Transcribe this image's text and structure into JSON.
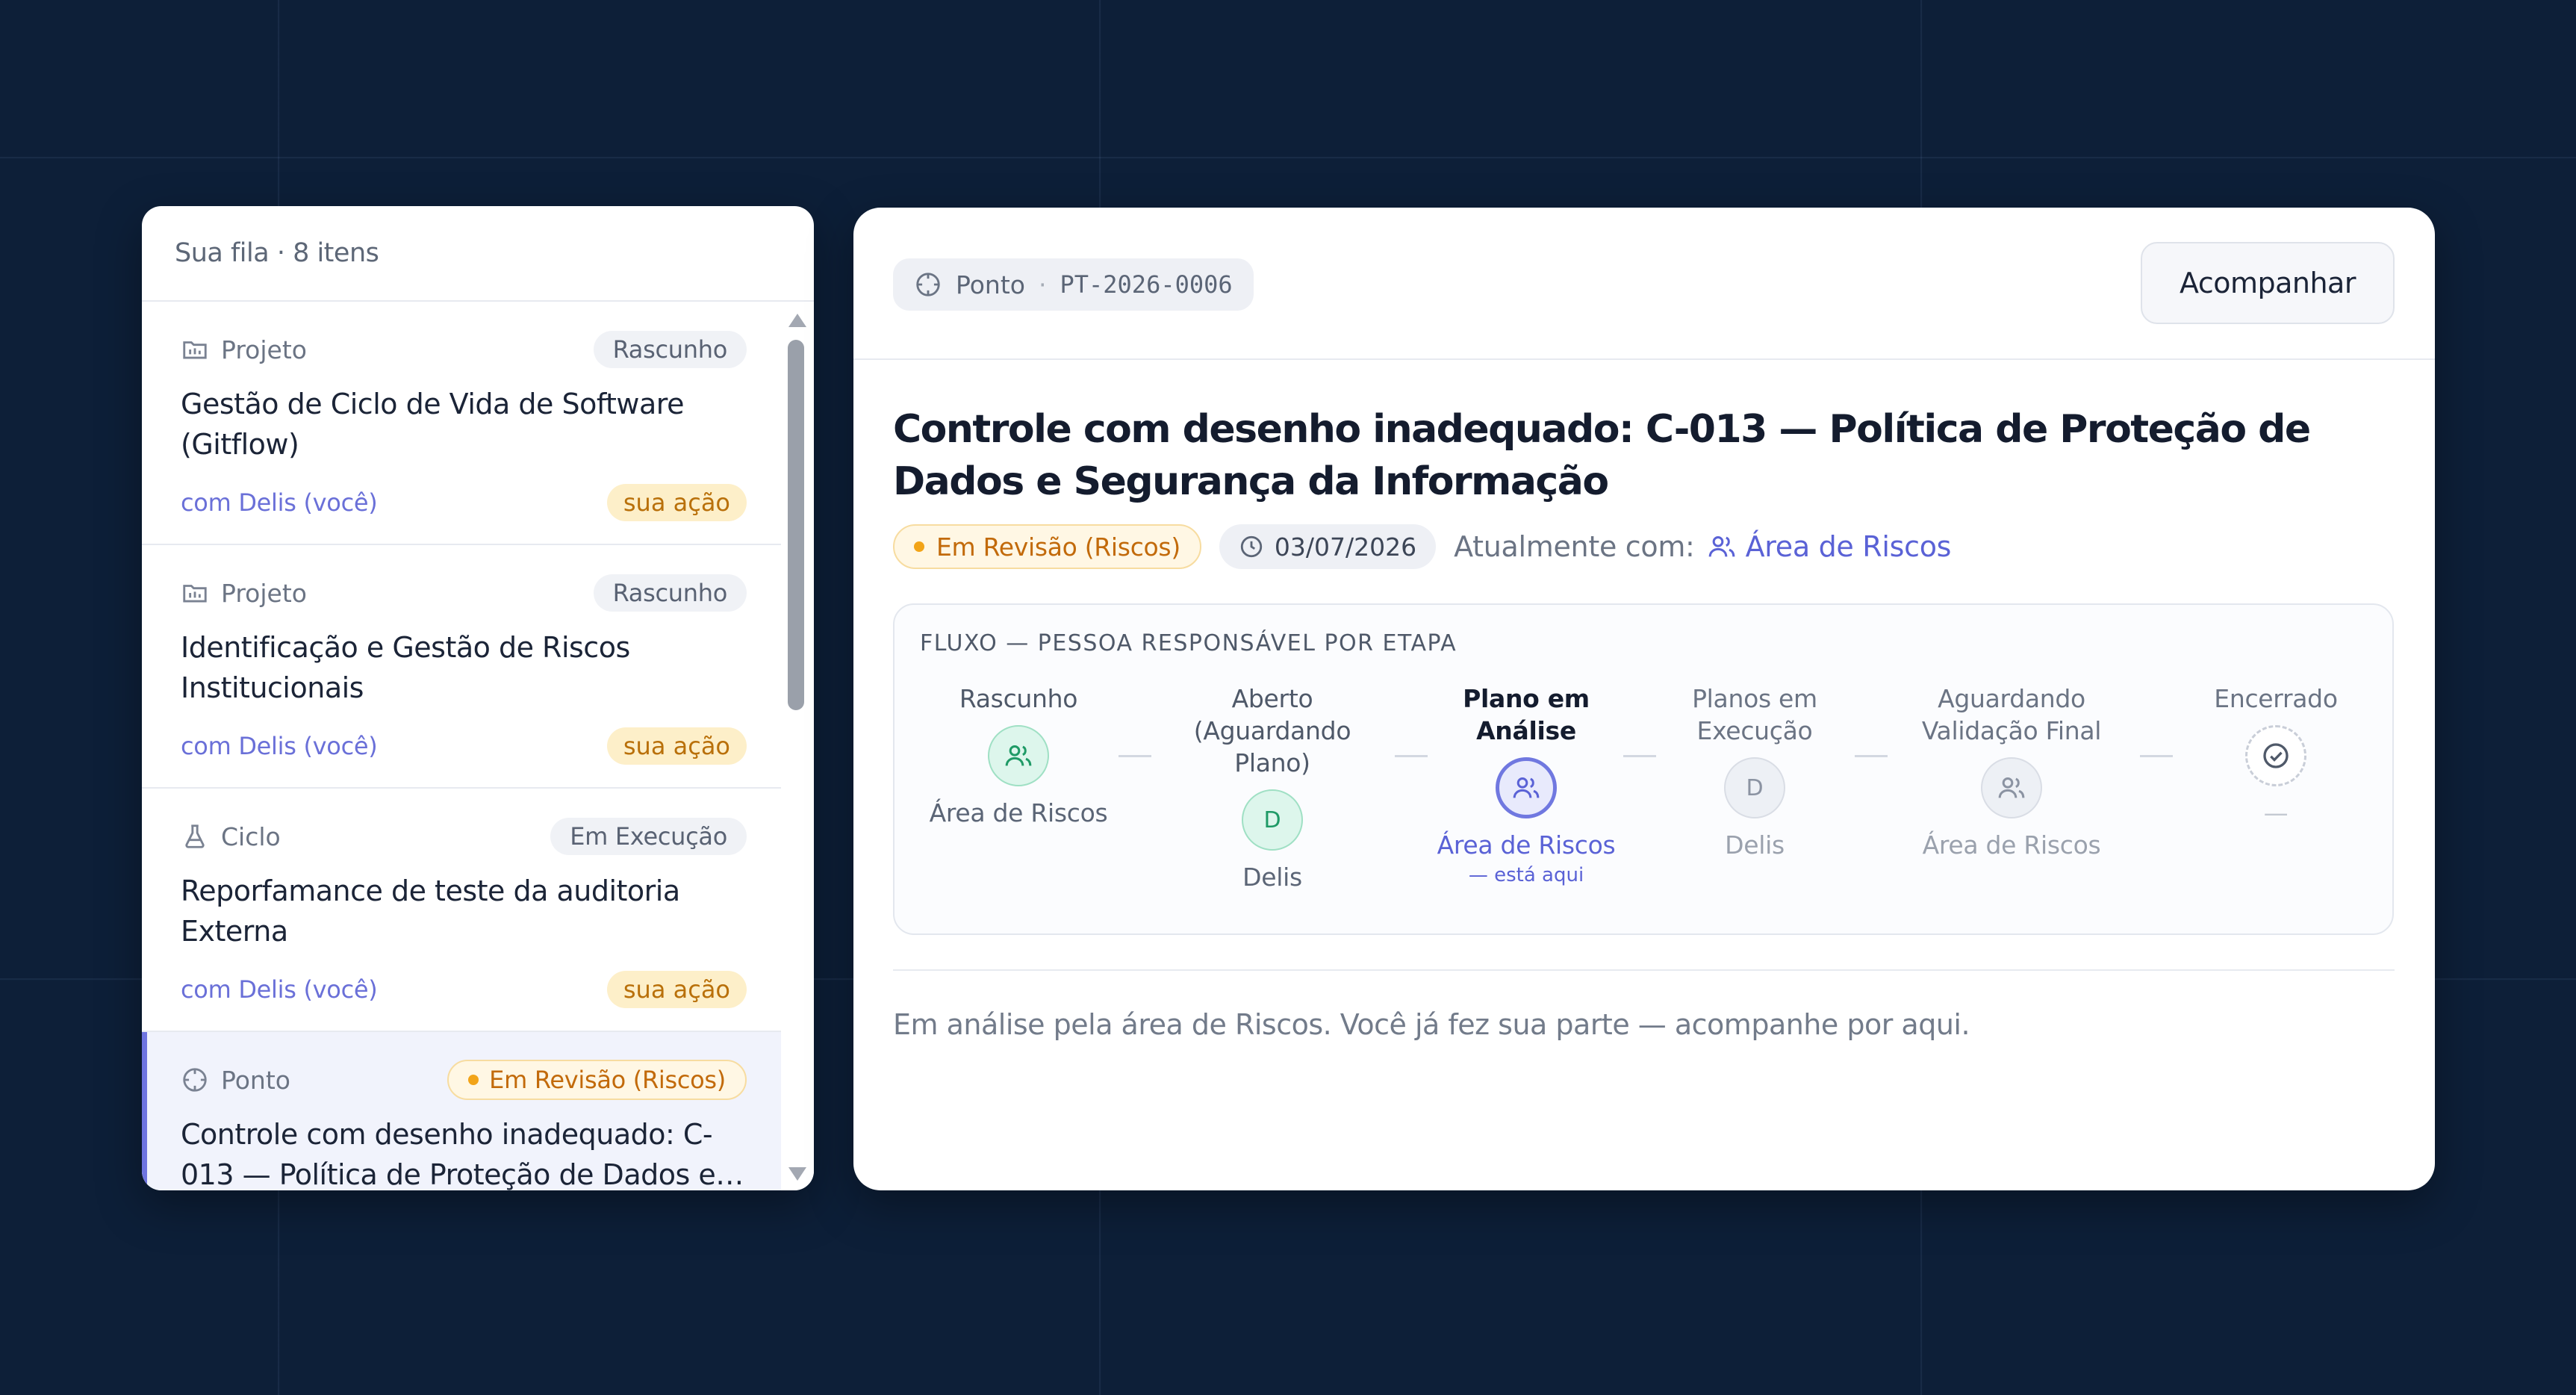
{
  "queue": {
    "header": "Sua fila · 8 itens",
    "items": [
      {
        "type": "Projeto",
        "type_icon": "folder-icon",
        "status": "Rascunho",
        "title": "Gestão de Ciclo de Vida de Software (Gitflow)",
        "with": "com Delis (você)",
        "action": "sua ação"
      },
      {
        "type": "Projeto",
        "type_icon": "folder-icon",
        "status": "Rascunho",
        "title": "Identificação e Gestão de Riscos Institucionais",
        "with": "com Delis (você)",
        "action": "sua ação"
      },
      {
        "type": "Ciclo",
        "type_icon": "flask-icon",
        "status": "Em Execução",
        "title": "Reporfamance de teste da auditoria Externa",
        "with": "com Delis (você)",
        "action": "sua ação"
      },
      {
        "type": "Ponto",
        "type_icon": "target-icon",
        "status": "Em Revisão (Riscos)",
        "title": "Controle com desenho inadequado: C-013 — Política de Proteção de Dados e…",
        "with": "",
        "action": ""
      }
    ]
  },
  "detail": {
    "ref_type": "Ponto",
    "ref_sep": "·",
    "ref_code": "PT-2026-0006",
    "follow_button": "Acompanhar",
    "title": "Controle com desenho inadequado: C-013 — Política de Proteção de Dados e Segurança da Informação",
    "status": "Em Revisão (Riscos)",
    "date": "03/07/2026",
    "currently_with_label": "Atualmente com:",
    "currently_with": "Área de Riscos",
    "flow": {
      "heading": "FLUXO — PESSOA RESPONSÁVEL POR ETAPA",
      "steps": [
        {
          "label": "Rascunho",
          "owner": "Área de Riscos",
          "state": "done",
          "node": "users-icon"
        },
        {
          "label": "Aberto (Aguardando Plano)",
          "owner": "Delis",
          "state": "done",
          "node": "D"
        },
        {
          "label": "Plano em Análise",
          "owner": "Área de Riscos",
          "state": "current",
          "node": "users-icon",
          "here": "— está aqui"
        },
        {
          "label": "Planos em Execução",
          "owner": "Delis",
          "state": "pending",
          "node": "D"
        },
        {
          "label": "Aguardando Validação Final",
          "owner": "Área de Riscos",
          "state": "pending",
          "node": "users-icon"
        },
        {
          "label": "Encerrado",
          "owner": "—",
          "state": "end",
          "node": "check-circle-icon"
        }
      ]
    },
    "note": "Em análise pela área de Riscos. Você já fez sua parte — acompanhe por aqui."
  },
  "colors": {
    "background": "#0d1f38",
    "accent": "#5a62d6",
    "review_orange": "#c26a0a",
    "action_bg": "#fdefc9",
    "done_green": "#1f9a66"
  }
}
